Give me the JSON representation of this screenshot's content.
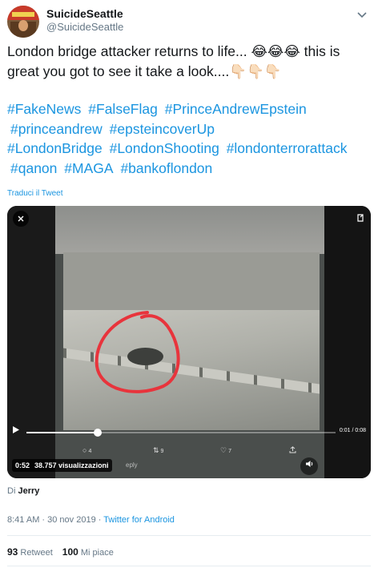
{
  "author": {
    "name": "SuicideSeattle",
    "handle": "@SuicideSeattle",
    "avatar_icon": "avatar-image"
  },
  "tweet": {
    "text": "London bridge attacker returns to life... 😂😂😂 this is great you got to see it take a look....👇🏻👇🏻👇🏻",
    "hashtags": [
      "#FakeNews",
      "#FalseFlag",
      "#PrinceAndrewEpstein",
      "#princeandrew",
      "#epsteincoverUp",
      "#LondonBridge",
      "#LondonShooting",
      "#londonterrorattack",
      "#qanon",
      "#MAGA",
      "#bankoflondon"
    ],
    "translate_label": "Traduci il Tweet"
  },
  "video": {
    "current_time": "0:01",
    "total_time": "0:08",
    "time_display": "0:01 / 0:08",
    "progress": 0.23,
    "embedded_stats": {
      "replies": "4",
      "retweets": "9",
      "likes": "7"
    },
    "badge_time": "0:52",
    "views": "38.757 visualizzazioni",
    "overlay_text": "eply",
    "accent_circle_color": "#e8343c"
  },
  "attribution": {
    "prefix": "Di",
    "author": "Jerry"
  },
  "meta": {
    "timestamp": "8:41 AM · 30 nov 2019",
    "separator": " · ",
    "source": "Twitter for Android"
  },
  "stats": {
    "retweets_count": "93",
    "retweets_label": "Retweet",
    "likes_count": "100",
    "likes_label": "Mi piace"
  },
  "colors": {
    "link": "#1b95e0",
    "text": "#14171a",
    "muted": "#657786"
  }
}
